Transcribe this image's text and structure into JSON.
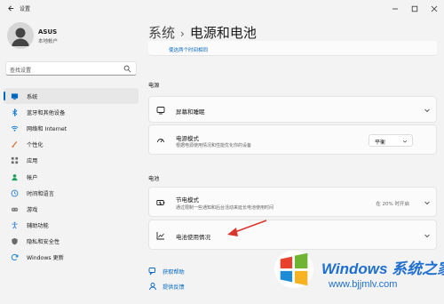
{
  "window": {
    "title": "设置",
    "controls": [
      "minimize",
      "maximize",
      "close"
    ]
  },
  "sidebar": {
    "user_name": "ASUS",
    "user_type": "本地帐户",
    "search_placeholder": "查找设置",
    "items": [
      {
        "label": "系统",
        "icon": "system-icon",
        "color": "#0067c0",
        "active": true
      },
      {
        "label": "蓝牙和其他设备",
        "icon": "bluetooth-icon",
        "color": "#0a78d7"
      },
      {
        "label": "网络和 Internet",
        "icon": "wifi-icon",
        "color": "#0a78d7"
      },
      {
        "label": "个性化",
        "icon": "brush-icon",
        "color": "#e06a2c"
      },
      {
        "label": "应用",
        "icon": "apps-icon",
        "color": "#6b6b6b"
      },
      {
        "label": "帐户",
        "icon": "person-icon",
        "color": "#1aa05a"
      },
      {
        "label": "时间和语言",
        "icon": "globe-clock-icon",
        "color": "#2b7fd6"
      },
      {
        "label": "游戏",
        "icon": "gamepad-icon",
        "color": "#7a7a7a"
      },
      {
        "label": "辅助功能",
        "icon": "accessibility-icon",
        "color": "#2b7fd6"
      },
      {
        "label": "隐私和安全性",
        "icon": "shield-icon",
        "color": "#6b6b6b"
      },
      {
        "label": "Windows 更新",
        "icon": "update-icon",
        "color": "#0a78d7"
      }
    ]
  },
  "content": {
    "breadcrumb_root": "系统",
    "breadcrumb_separator": "›",
    "page_title": "电源和电池",
    "top_link": "使这两个时间相同",
    "power_section": "电源",
    "screen_sleep": {
      "title": "屏幕和睡眠"
    },
    "power_mode": {
      "title": "电源模式",
      "subtitle": "根据电源使用情况和性能优化你的设备",
      "value": "平衡"
    },
    "battery_section": "电池",
    "battery_saver": {
      "title": "节电模式",
      "subtitle": "通过限制一些通知和后台活动来延长电池使用时间",
      "status": "在 20% 时开启"
    },
    "battery_usage": {
      "title": "电池使用情况"
    },
    "help": {
      "get_help": "获取帮助",
      "feedback": "提供反馈"
    }
  },
  "watermark": {
    "title": "Windows 系统之家",
    "url": "www.bjjmlv.com"
  },
  "colors": {
    "accent": "#0067c0",
    "annotation_arrow": "#d9362b"
  }
}
